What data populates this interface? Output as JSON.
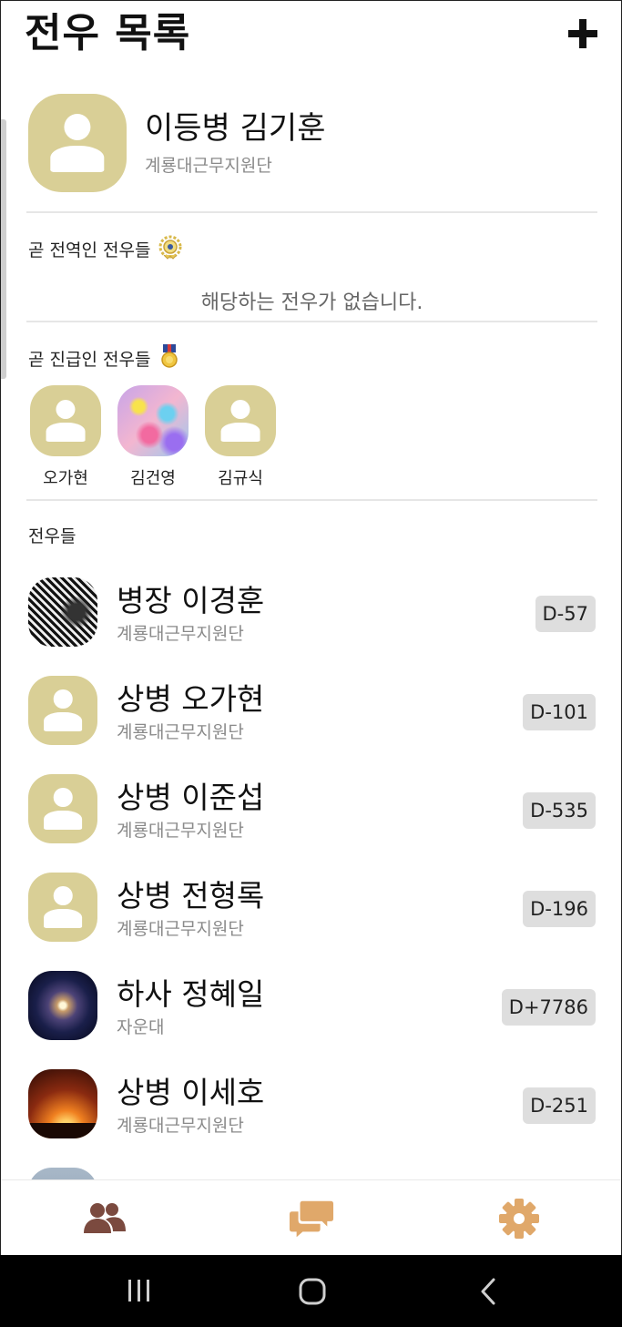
{
  "header": {
    "title": "전우 목록"
  },
  "me": {
    "name": "이등병 김기훈",
    "unit": "계룡대근무지원단"
  },
  "sections": {
    "discharge_title": "곧 전역인 전우들",
    "discharge_empty": "해당하는 전우가 없습니다.",
    "promotion_title": "곧 진급인 전우들",
    "comrades_title": "전우들"
  },
  "promotion": [
    {
      "name": "오가현",
      "avatar": "default"
    },
    {
      "name": "김건영",
      "avatar": "photo"
    },
    {
      "name": "김규식",
      "avatar": "default"
    }
  ],
  "comrades": [
    {
      "name": "병장 이경훈",
      "unit": "계룡대근무지원단",
      "dday": "D-57",
      "avatar": "photo"
    },
    {
      "name": "상병 오가현",
      "unit": "계룡대근무지원단",
      "dday": "D-101",
      "avatar": "default"
    },
    {
      "name": "상병 이준섭",
      "unit": "계룡대근무지원단",
      "dday": "D-535",
      "avatar": "default"
    },
    {
      "name": "상병 전형록",
      "unit": "계룡대근무지원단",
      "dday": "D-196",
      "avatar": "default"
    },
    {
      "name": "하사 정혜일",
      "unit": "자운대",
      "dday": "D+7786",
      "avatar": "photo"
    },
    {
      "name": "상병 이세호",
      "unit": "계룡대근무지원단",
      "dday": "D-251",
      "avatar": "photo"
    }
  ],
  "icons": {
    "add": "plus-icon",
    "discharge_medal": "medal-gold-icon",
    "promotion_medal": "medal-ribbon-icon",
    "nav_friends": "users-icon",
    "nav_chat": "chat-icon",
    "nav_settings": "gear-icon"
  },
  "colors": {
    "avatar_bg": "#d9cf96",
    "nav_active": "#7b4a3f",
    "nav_inactive": "#e0a86a",
    "badge_bg": "#dedede"
  }
}
